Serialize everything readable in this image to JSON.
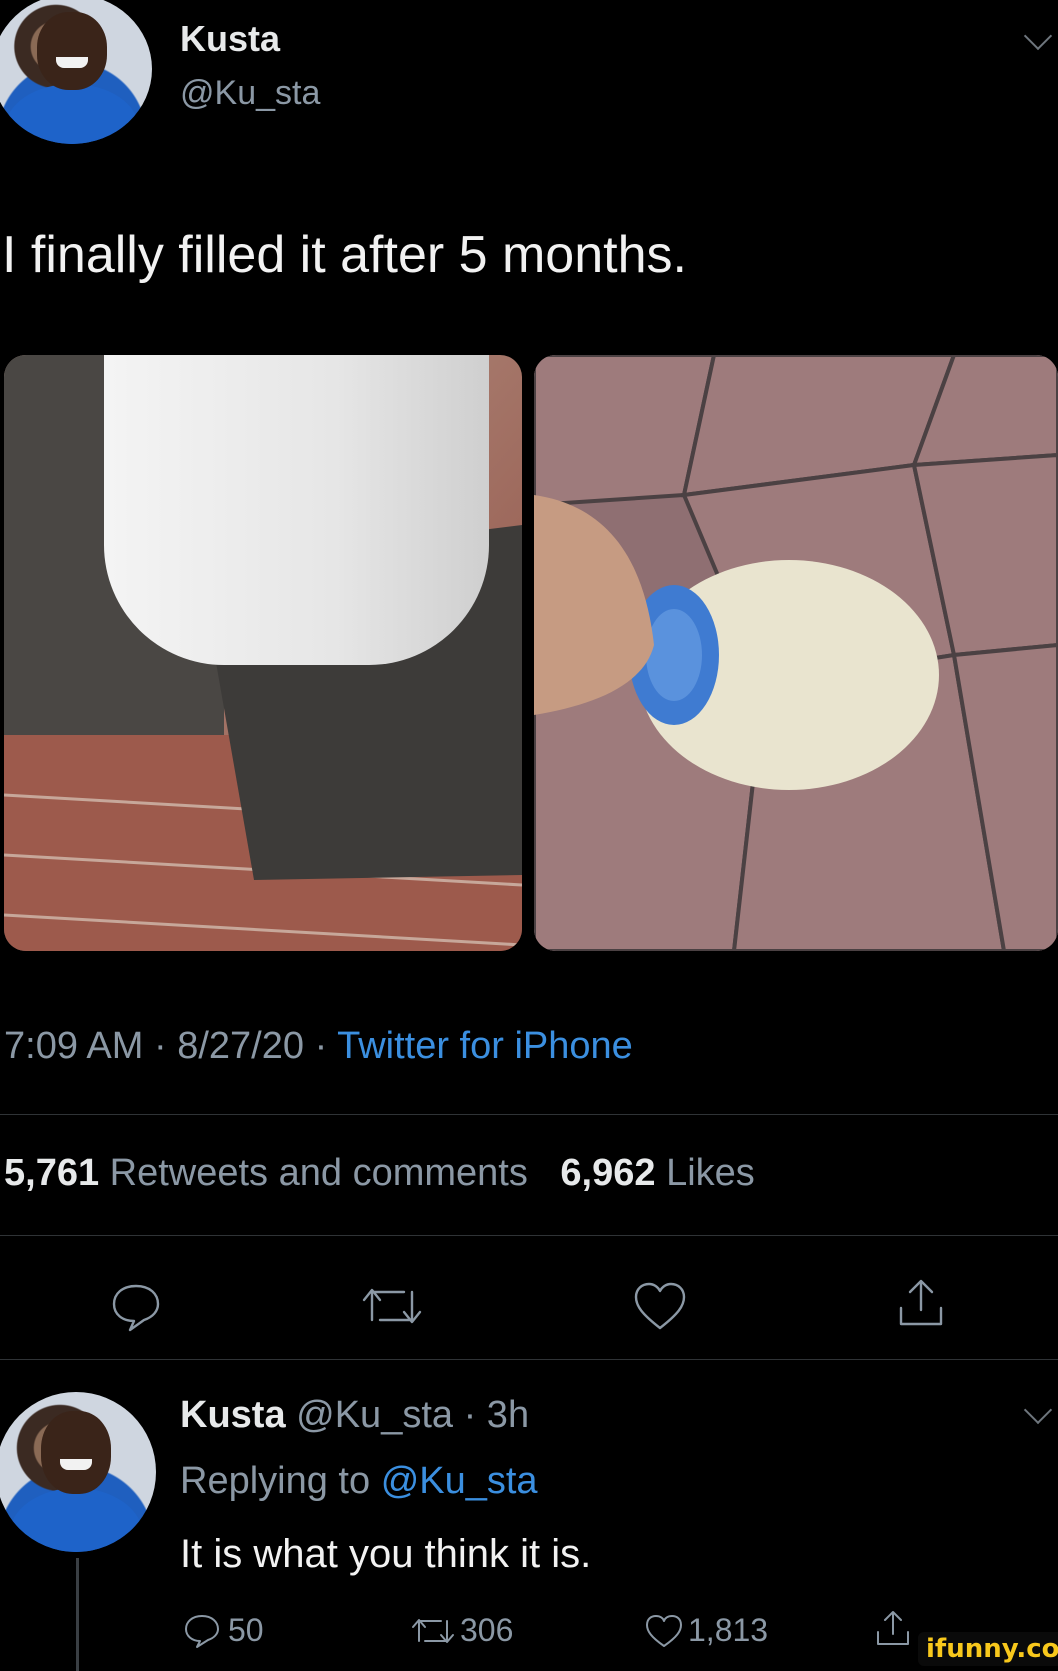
{
  "tweet": {
    "author_name": "Kusta",
    "handle": "@Ku_sta",
    "text": "I finally filled it after 5 months.",
    "time": "7:09 AM",
    "date": "8/27/20",
    "sep": "·",
    "source": "Twitter for iPhone",
    "retweets_count": "5,761",
    "retweets_label": "Retweets and comments",
    "likes_count": "6,962",
    "likes_label": "Likes"
  },
  "reply": {
    "author_name": "Kusta",
    "handle": "@Ku_sta",
    "age": "· 3h",
    "replying_prefix": "Replying to",
    "replying_handle": "@Ku_sta",
    "text": "It is what you think it is.",
    "comments": "50",
    "retweets": "306",
    "likes": "1,813"
  },
  "watermark": "ifunny.co",
  "colors": {
    "background": "#000000",
    "link": "#3b8fe0",
    "muted": "#8b98a5",
    "divider": "#2f3336"
  },
  "icons": [
    "comment-icon",
    "retweet-icon",
    "like-icon",
    "share-icon",
    "chevron-down-icon"
  ]
}
